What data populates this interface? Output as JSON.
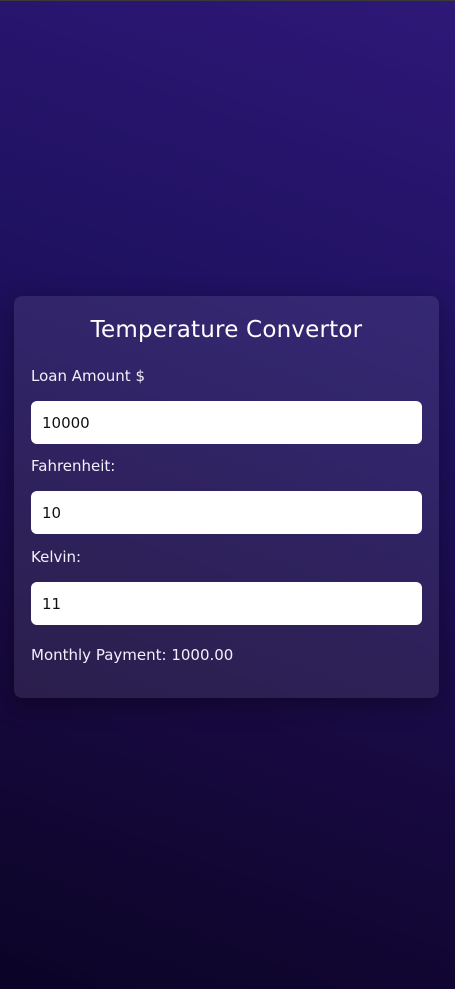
{
  "app": {
    "title": "Temperature Convertor"
  },
  "form": {
    "loan_label": "Loan Amount $",
    "loan_value": "10000",
    "fahrenheit_label": "Fahrenheit:",
    "fahrenheit_value": "10",
    "kelvin_label": "Kelvin:",
    "kelvin_value": "11"
  },
  "result": {
    "monthly_payment_text": "Monthly Payment: 1000.00"
  },
  "colors": {
    "background_top": "#2e1878",
    "background_bottom": "#0b0426",
    "card_overlay": "rgba(255,255,255,0.09)",
    "input_background": "#ffffff",
    "text": "#ffffff"
  }
}
